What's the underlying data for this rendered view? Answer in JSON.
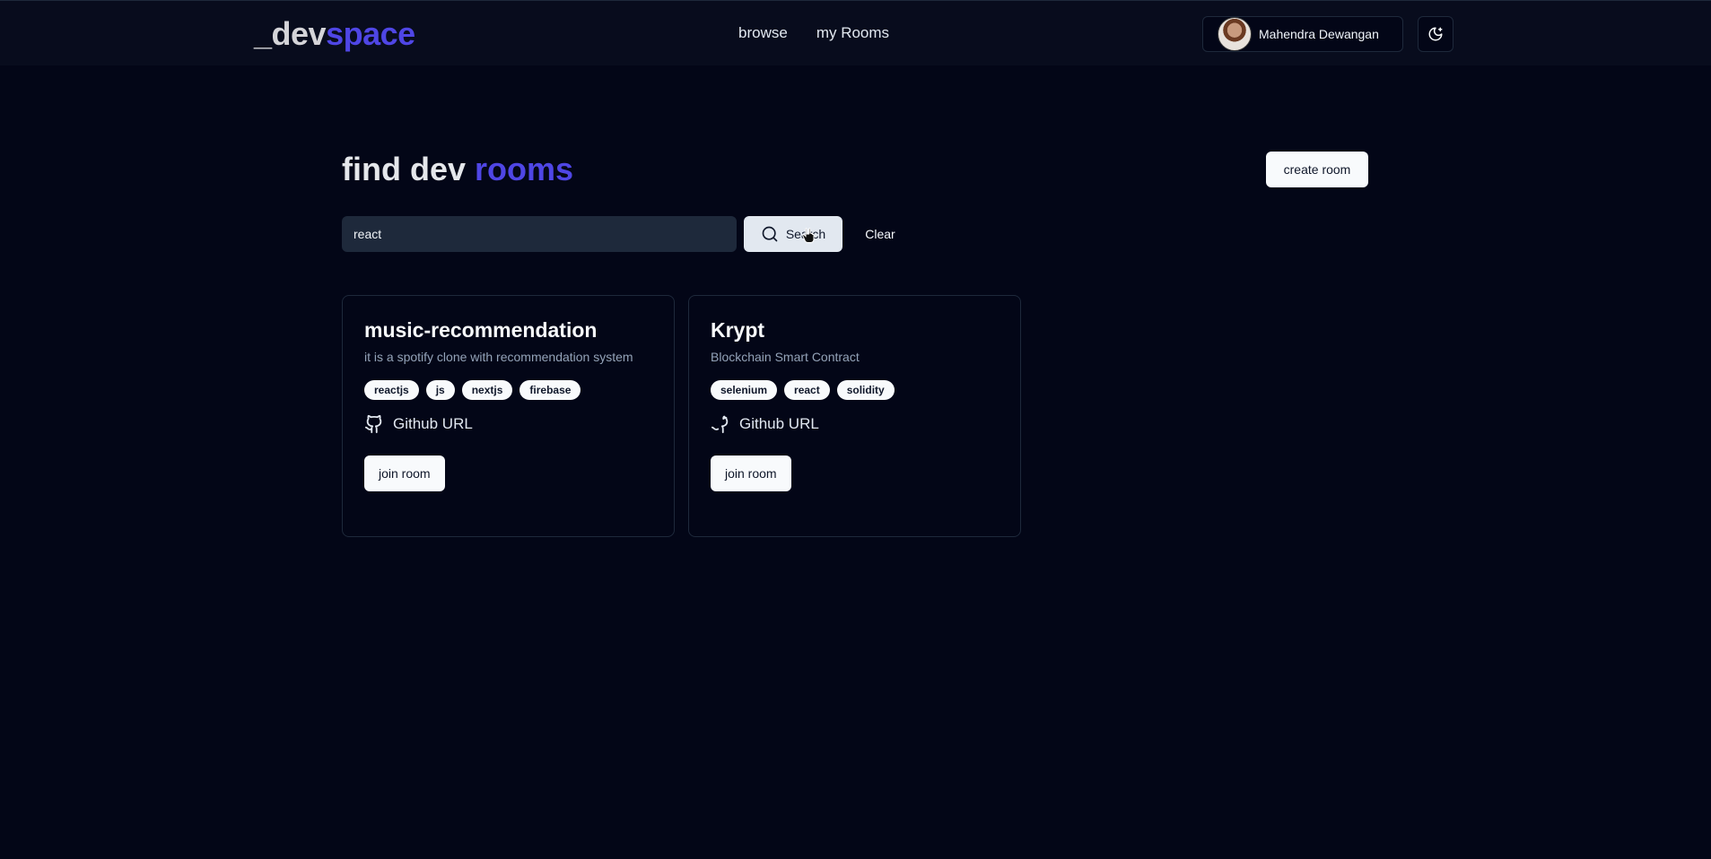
{
  "header": {
    "logo_part1": "_dev",
    "logo_part2": "space",
    "nav": [
      {
        "label": "browse"
      },
      {
        "label": "my Rooms"
      }
    ],
    "user_name": "Mahendra Dewangan",
    "theme_icon": "moon-sun-icon"
  },
  "main": {
    "title_part1": "find dev ",
    "title_part2": "rooms",
    "create_label": "create room",
    "search": {
      "value": "react",
      "button_label": "Search",
      "clear_label": "Clear"
    }
  },
  "rooms": [
    {
      "name": "music-recommendation",
      "description": "it is a spotify clone with recommendation system",
      "tags": [
        "reactjs",
        "js",
        "nextjs",
        "firebase"
      ],
      "github_label": "Github URL",
      "join_label": "join room"
    },
    {
      "name": "Krypt",
      "description": "Blockchain Smart Contract",
      "tags": [
        "selenium",
        "react",
        "solidity"
      ],
      "github_label": "Github URL",
      "join_label": "join room"
    }
  ],
  "colors": {
    "background": "#030617",
    "accent": "#4f46e5",
    "header": "#080c1d"
  }
}
